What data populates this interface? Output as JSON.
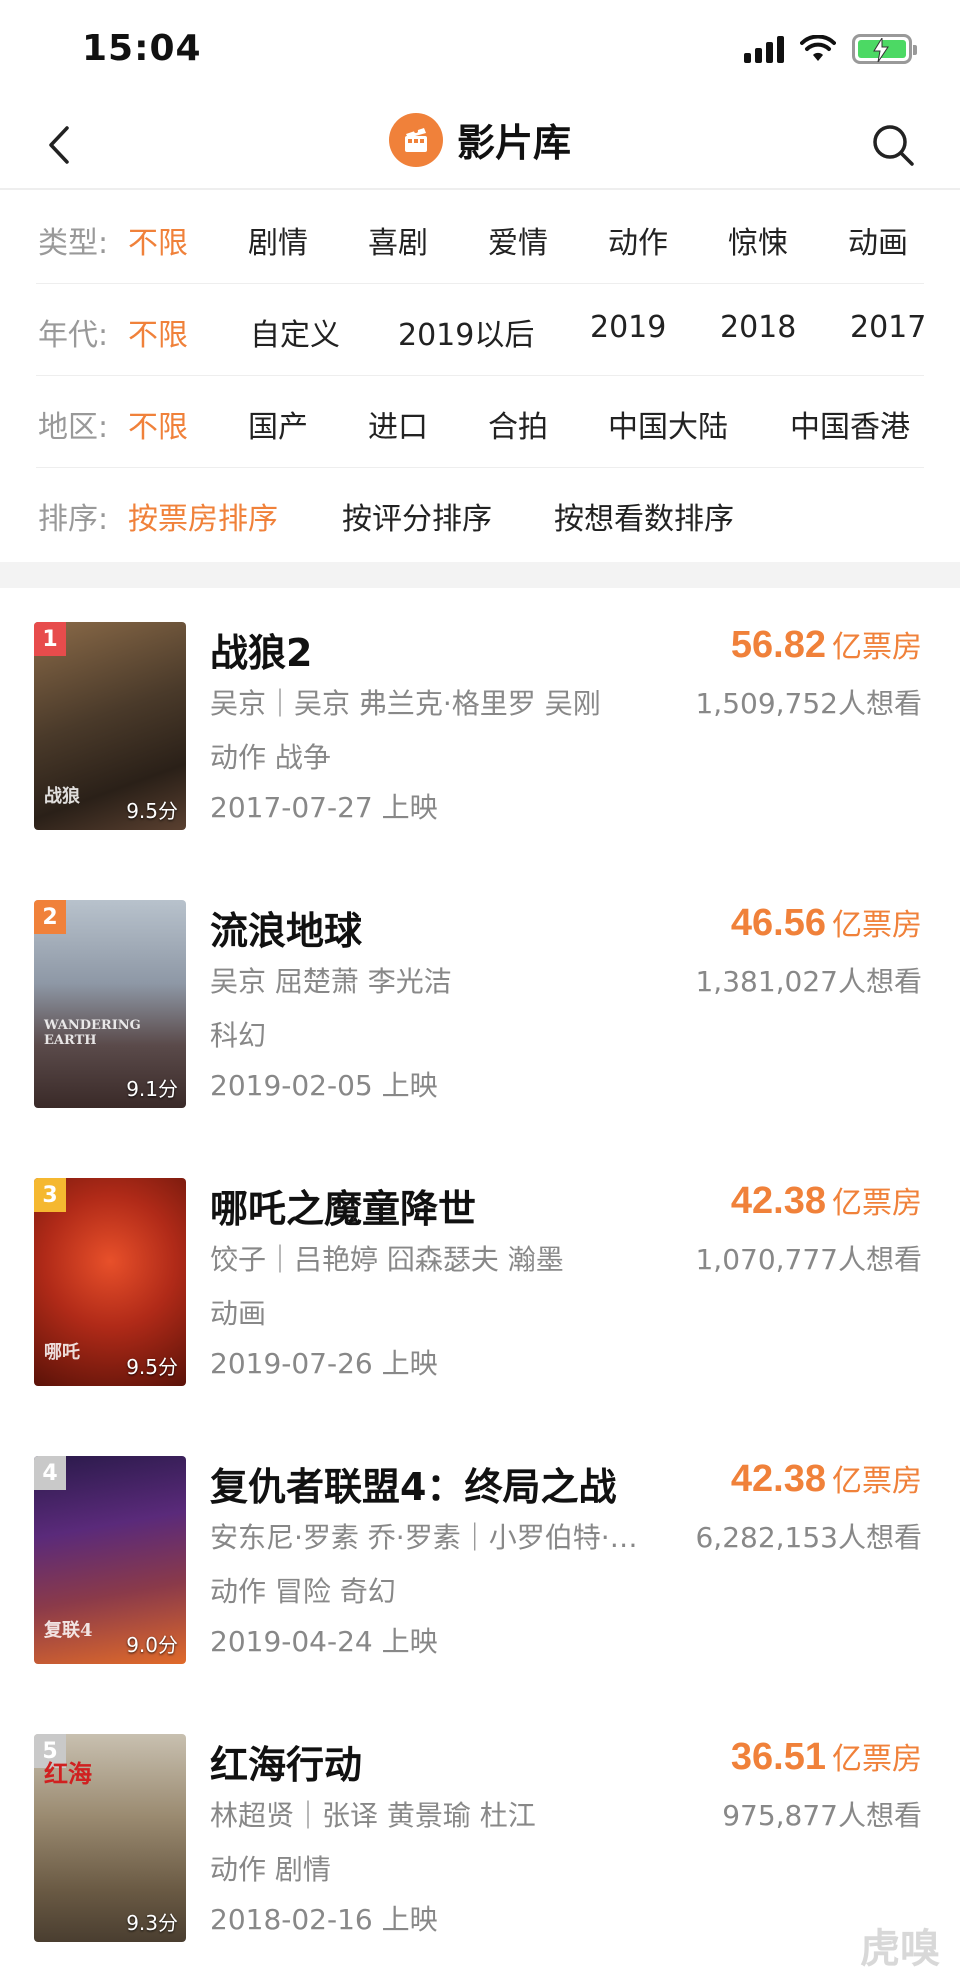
{
  "status": {
    "time": "15:04"
  },
  "nav": {
    "title": "影片库",
    "logo_icon": "film-camera-icon",
    "back_icon": "chevron-left-icon",
    "search_icon": "search-icon",
    "accent": "#f0813a"
  },
  "filters": {
    "type": {
      "label": "类型:",
      "options": [
        "不限",
        "剧情",
        "喜剧",
        "爱情",
        "动作",
        "惊悚",
        "动画"
      ],
      "selected": "不限"
    },
    "year": {
      "label": "年代:",
      "options": [
        "不限",
        "自定义",
        "2019以后",
        "2019",
        "2018",
        "2017"
      ],
      "selected": "不限"
    },
    "region": {
      "label": "地区:",
      "options": [
        "不限",
        "国产",
        "进口",
        "合拍",
        "中国大陆",
        "中国香港"
      ],
      "selected": "不限"
    },
    "sort": {
      "label": "排序:",
      "options": [
        "按票房排序",
        "按评分排序",
        "按想看数排序"
      ],
      "selected": "按票房排序"
    }
  },
  "movies": [
    {
      "rank": "1",
      "rank_color": "#e74c4c",
      "title": "战狼2",
      "cast": "吴京｜吴京 弗兰克·格里罗 吴刚",
      "genre": "动作 战争",
      "date": "2017-07-27 上映",
      "box": "56.82",
      "box_unit": "亿票房",
      "want": "1,509,752人想看",
      "score": "9.5分",
      "poster_art": "战狼"
    },
    {
      "rank": "2",
      "rank_color": "#f0813a",
      "title": "流浪地球",
      "cast": "吴京 屈楚萧 李光洁",
      "genre": "科幻",
      "date": "2019-02-05 上映",
      "box": "46.56",
      "box_unit": "亿票房",
      "want": "1,381,027人想看",
      "score": "9.1分",
      "poster_art": "WANDERING EARTH"
    },
    {
      "rank": "3",
      "rank_color": "#f5b830",
      "title": "哪吒之魔童降世",
      "cast": "饺子｜吕艳婷 囧森瑟夫 瀚墨",
      "genre": "动画",
      "date": "2019-07-26 上映",
      "box": "42.38",
      "box_unit": "亿票房",
      "want": "1,070,777人想看",
      "score": "9.5分",
      "poster_art": "哪吒"
    },
    {
      "rank": "4",
      "rank_color": "#c9c9c9",
      "title": "复仇者联盟4：终局之战",
      "cast": "安东尼·罗素 乔·罗素｜小罗伯特·唐尼",
      "genre": "动作 冒险 奇幻",
      "date": "2019-04-24 上映",
      "box": "42.38",
      "box_unit": "亿票房",
      "want": "6,282,153人想看",
      "score": "9.0分",
      "poster_art": "复联4"
    },
    {
      "rank": "5",
      "rank_color": "#c9c9c9",
      "title": "红海行动",
      "cast": "林超贤｜张译 黄景瑜 杜江",
      "genre": "动作 剧情",
      "date": "2018-02-16 上映",
      "box": "36.51",
      "box_unit": "亿票房",
      "want": "975,877人想看",
      "score": "9.3分",
      "poster_art": "红海"
    }
  ],
  "watermark": "虎嗅"
}
